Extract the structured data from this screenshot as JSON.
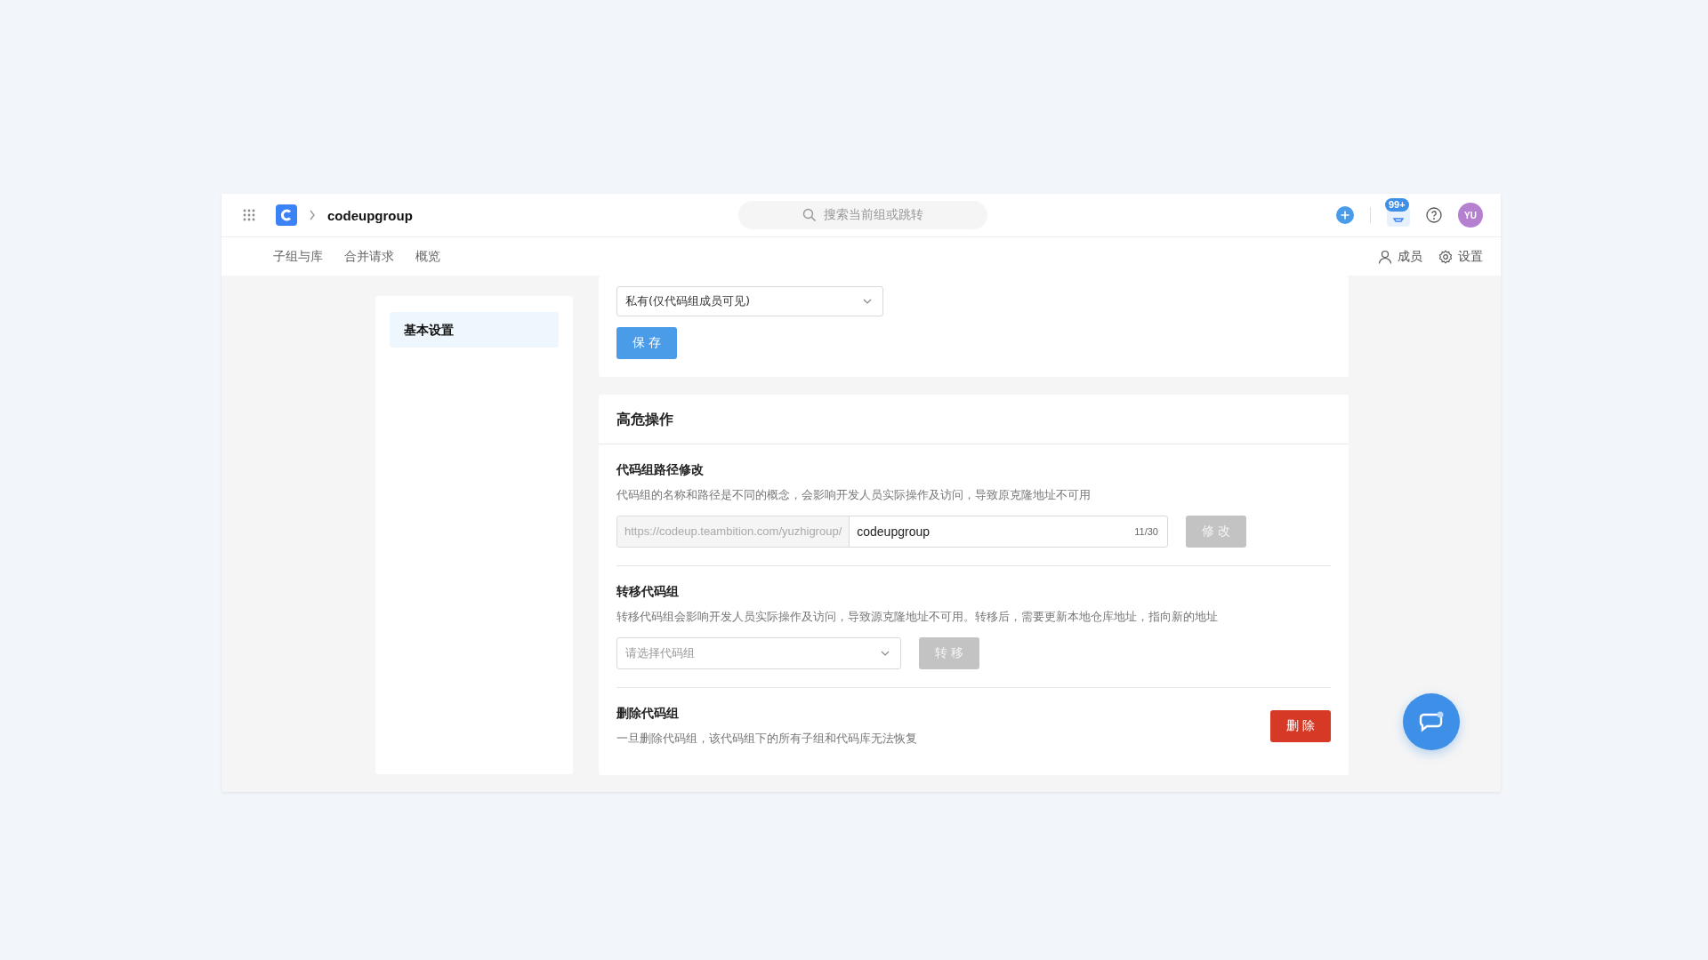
{
  "header": {
    "breadcrumb": "codeupgroup",
    "search": {
      "placeholder": "搜索当前组或跳转"
    },
    "notification_count": "99+",
    "avatar": "YU"
  },
  "nav": {
    "tabs": [
      {
        "label": "子组与库",
        "selected": false
      },
      {
        "label": "合并请求",
        "selected": false
      },
      {
        "label": "概览",
        "selected": false
      }
    ],
    "actions": [
      {
        "label": "成员",
        "kind": "member"
      },
      {
        "label": "设置",
        "kind": "settings"
      }
    ]
  },
  "sidebar": {
    "items": [
      {
        "label": "基本设置",
        "selected": true
      }
    ]
  },
  "visibility": {
    "value": "私有(仅代码组成员可见)",
    "button": "保 存"
  },
  "danger": {
    "title": "高危操作",
    "sections": [
      {
        "kind": "path",
        "title": "代码组路径修改",
        "description": "代码组的名称和路径是不同的概念，会影响开发人员实际操作及访问，导致原克隆地址不可用",
        "prefix": "https://codeup.teambition.com/yuzhigroup/",
        "value": "codeupgroup",
        "count": "11/30",
        "button": "修 改",
        "disabled": true
      },
      {
        "kind": "transfer",
        "title": "转移代码组",
        "description": "转移代码组会影响开发人员实际操作及访问，导致源克隆地址不可用。转移后，需要更新本地仓库地址，指向新的地址",
        "placeholder": "请选择代码组",
        "button": "转 移",
        "disabled": true
      },
      {
        "kind": "delete",
        "title": "删除代码组",
        "description": "一旦删除代码组，该代码组下的所有子组和代码库无法恢复",
        "button": "删 除",
        "disabled": false
      }
    ]
  }
}
